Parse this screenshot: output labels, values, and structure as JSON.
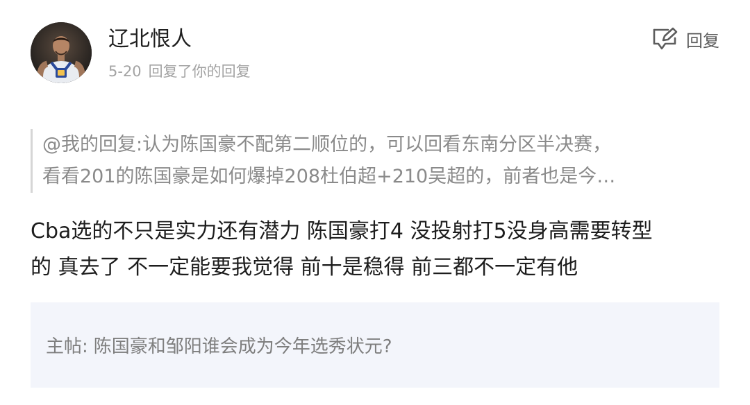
{
  "comment": {
    "username": "辽北恨人",
    "date": "5-20",
    "action_text": "回复了你的回复",
    "reply_button_label": "回复",
    "quote_lines": [
      "@我的回复:认为陈国豪不配第二顺位的，可以回看东南分区半决赛，",
      "看看201的陈国豪是如何爆掉208杜伯超+210吴超的，前者也是今…"
    ],
    "body_lines": [
      "Cba选的不只是实力还有潜力 陈国豪打4 没投射打5没身高需要转型",
      "的 真去了 不一定能要我觉得 前十是稳得 前三都不一定有他"
    ],
    "main_post_label": "主帖:",
    "main_post_title": "陈国豪和邹阳谁会成为今年选秀状元?"
  },
  "icons": {
    "reply": "edit-reply-icon"
  },
  "colors": {
    "username": "#1f1f1f",
    "meta": "#a3a3a3",
    "quote_text": "#8a8a8a",
    "body_text": "#1d1d1d",
    "main_post_bg": "#f3f5fb"
  }
}
